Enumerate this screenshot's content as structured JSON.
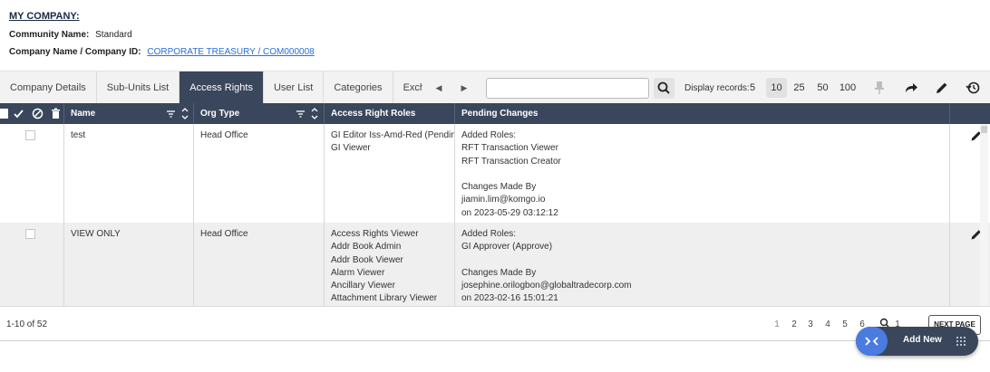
{
  "company": {
    "title": "MY COMPANY:",
    "community_label": "Community Name:",
    "community_value": "Standard",
    "company_label": "Company Name / Company ID:",
    "company_value": "CORPORATE TREASURY / COM000008"
  },
  "tabs": [
    {
      "label": "Company Details"
    },
    {
      "label": "Sub-Units List"
    },
    {
      "label": "Access Rights",
      "active": true
    },
    {
      "label": "User List"
    },
    {
      "label": "Categories"
    },
    {
      "label": "Exchange Rat"
    }
  ],
  "toolbar": {
    "search_value": "",
    "display_label": "Display records:",
    "page_sizes": [
      "5",
      "10",
      "25",
      "50",
      "100"
    ],
    "selected_page_size": "10",
    "icons": [
      "pin-icon",
      "share-icon",
      "pencil-icon",
      "history-icon"
    ]
  },
  "table": {
    "columns": [
      "Name",
      "Org Type",
      "Access Right Roles",
      "Pending Changes"
    ],
    "rows": [
      {
        "name": "test",
        "org_type": "Head Office",
        "roles": [
          "GI Editor Iss-Amd-Red (Pending Cor",
          "GI Viewer"
        ],
        "pending": [
          "Added Roles:",
          "RFT Transaction Viewer",
          "RFT Transaction Creator",
          "",
          "Changes Made By",
          "jiamin.lim@komgo.io",
          "on  2023-05-29 03:12:12"
        ]
      },
      {
        "name": "VIEW ONLY",
        "org_type": "Head Office",
        "roles": [
          "Access Rights Viewer",
          "Addr Book Admin",
          "Addr Book Viewer",
          "Alarm Viewer",
          "Ancillary Viewer",
          "Attachment Library Viewer"
        ],
        "pending": [
          "Added Roles:",
          "GI Approver (Approve)",
          "",
          "Changes Made By",
          "josephine.orilogbon@globaltradecorp.com",
          "on  2023-02-16 15:01:21"
        ]
      }
    ]
  },
  "footer": {
    "record_count": "1-10 of 52",
    "pages": [
      "1",
      "2",
      "3",
      "4",
      "5",
      "6"
    ],
    "current_page": "1",
    "jump_value": "1",
    "next_label": "NEXT PAGE"
  },
  "fab": {
    "label": "Add New"
  },
  "colors": {
    "header_bg": "#3a465b",
    "link": "#2a6fd6",
    "fab_toggle": "#4a7be0"
  }
}
